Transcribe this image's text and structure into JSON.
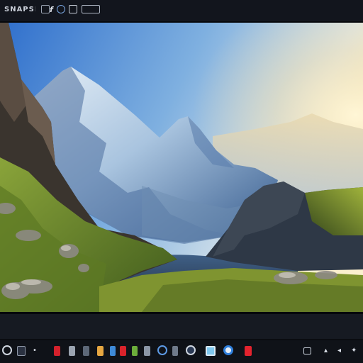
{
  "window": {
    "title": "SNAPSHOT",
    "toolbar_icons": [
      "image-icon",
      "crop-icon",
      "italic-icon",
      "settings-icon",
      "copy-icon",
      "download-icon"
    ]
  },
  "viewer": {
    "subject": "mountain-landscape-photo",
    "colors": {
      "sky_top": "#3b7ad3",
      "sky_mid": "#8fb8e0",
      "sun_glow": "#fdf1c8",
      "peak_light": "#d4e4f2",
      "peak_shadow": "#3a5e8e",
      "grass": "#6f8a27",
      "rock": "#3d3a35"
    }
  },
  "taskbar": {
    "start_icon": "search-icon",
    "app_icons": [
      "red-app-icon",
      "tile-icon",
      "orange-app-icon",
      "grid-icon",
      "red-app-icon",
      "grid-icon",
      "green-app-icon",
      "grid-icon",
      "chrome-icon",
      "globe-icon",
      "image-viewer-icon",
      "edge-icon",
      "red-app-icon"
    ],
    "tray_icons": [
      "battery-icon",
      "wifi-icon",
      "volume-icon",
      "settings-icon"
    ]
  }
}
